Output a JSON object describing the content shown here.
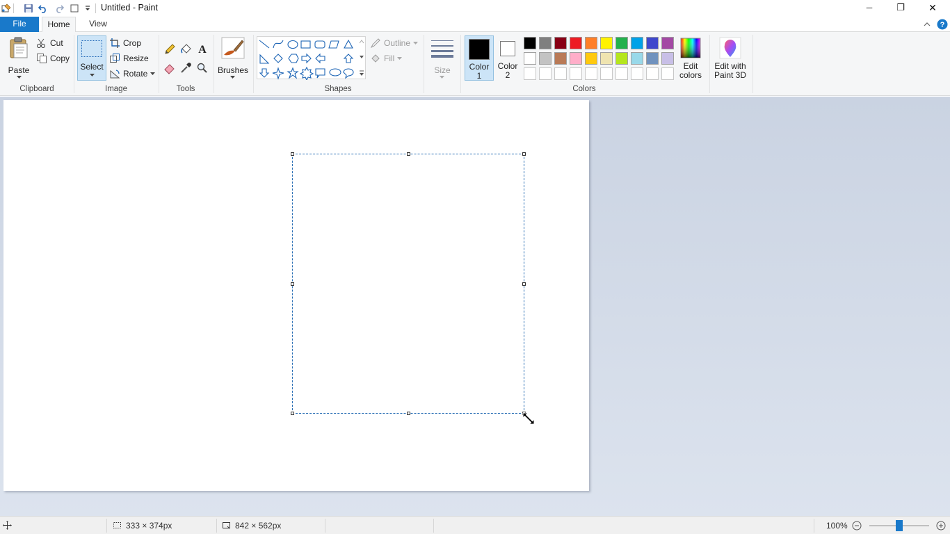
{
  "window": {
    "title": "Untitled - Paint",
    "minimize_glyph": "─",
    "restore_glyph": "❐",
    "close_glyph": "✕"
  },
  "tabs": {
    "file": "File",
    "home": "Home",
    "view": "View"
  },
  "ribbon": {
    "clipboard": {
      "label": "Clipboard",
      "paste": "Paste",
      "cut": "Cut",
      "copy": "Copy"
    },
    "image": {
      "label": "Image",
      "select": "Select",
      "crop": "Crop",
      "resize": "Resize",
      "rotate": "Rotate"
    },
    "tools": {
      "label": "Tools"
    },
    "brushes": {
      "label": "Brushes"
    },
    "shapes": {
      "label": "Shapes",
      "outline": "Outline",
      "fill": "Fill"
    },
    "size": {
      "label": "Size"
    },
    "colors": {
      "label": "Colors",
      "color1_line1": "Color",
      "color1_line2": "1",
      "color2_line1": "Color",
      "color2_line2": "2",
      "edit_line1": "Edit",
      "edit_line2": "colors",
      "color1_value": "#000000",
      "color2_value": "#ffffff",
      "palette_row1": [
        "#000000",
        "#7f7f7f",
        "#880015",
        "#ed1c24",
        "#ff7f27",
        "#fff200",
        "#22b14c",
        "#00a2e8",
        "#3f48cc",
        "#a349a4"
      ],
      "palette_row2": [
        "#ffffff",
        "#c3c3c3",
        "#b97a57",
        "#ffaec9",
        "#ffc90e",
        "#efe4b0",
        "#b5e61d",
        "#99d9ea",
        "#7092be",
        "#c8bfe7"
      ]
    },
    "paint3d": {
      "line1": "Edit with",
      "line2": "Paint 3D"
    }
  },
  "status": {
    "selection_size": "333 × 374px",
    "canvas_size": "842 × 562px",
    "zoom": "100%",
    "zoom_level_percent": 100
  }
}
